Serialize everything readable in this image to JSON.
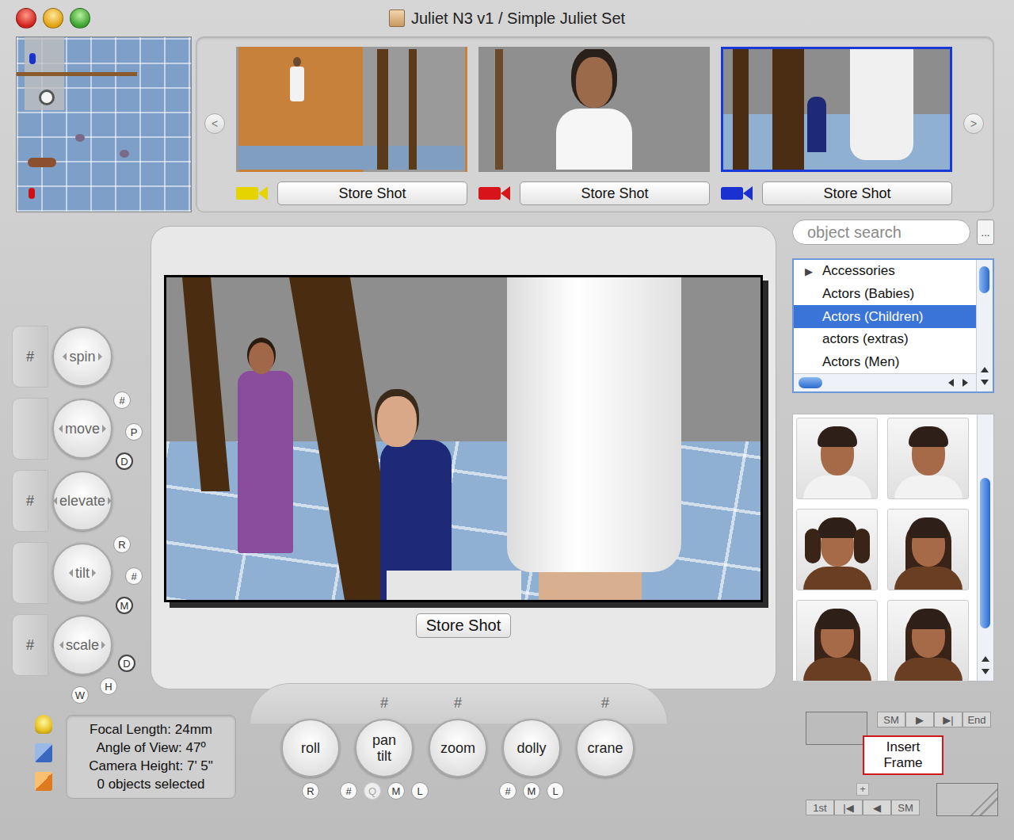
{
  "window": {
    "title": "Juliet N3 v1 / Simple Juliet Set"
  },
  "shot_strip": {
    "prev": "<",
    "next": ">",
    "shots": [
      {
        "camera_color": "#e6d400",
        "button": "Store Shot",
        "selected": false
      },
      {
        "camera_color": "#d8141a",
        "button": "Store Shot",
        "selected": false
      },
      {
        "camera_color": "#1a30d0",
        "button": "Store Shot",
        "selected": true
      }
    ]
  },
  "object_controls": [
    {
      "label": "spin",
      "side_mark": "#",
      "badges": []
    },
    {
      "label": "move",
      "badges": [
        "#",
        "P",
        "D"
      ]
    },
    {
      "label": "elevate",
      "side_mark": "#",
      "badges": []
    },
    {
      "label": "tilt",
      "badges": [
        "R",
        "#",
        "M"
      ]
    },
    {
      "label": "scale",
      "side_mark": "#",
      "badges": [
        "D",
        "H",
        "W"
      ]
    }
  ],
  "viewport": {
    "button": "Store Shot"
  },
  "camera_info": [
    "Focal Length: 24mm",
    "Angle of View: 47º",
    "Camera Height: 7' 5\"",
    "0 objects selected"
  ],
  "camera_controls": [
    {
      "label": "roll",
      "badges": [
        {
          "text": "R",
          "disabled": false
        }
      ]
    },
    {
      "label": "pan tilt",
      "top_mark": "#",
      "badges": [
        {
          "text": "#",
          "disabled": false
        },
        {
          "text": "Q",
          "disabled": true
        },
        {
          "text": "M",
          "disabled": false
        },
        {
          "text": "L",
          "disabled": false
        }
      ]
    },
    {
      "label": "zoom",
      "top_mark": "#",
      "badges": []
    },
    {
      "label": "dolly",
      "badges": [
        {
          "text": "#",
          "disabled": false
        },
        {
          "text": "M",
          "disabled": false
        },
        {
          "text": "L",
          "disabled": false
        }
      ]
    },
    {
      "label": "crane",
      "top_mark": "#",
      "badges": []
    }
  ],
  "library": {
    "search_placeholder": "object search",
    "options_button": "...",
    "disclosure_glyph": "▶",
    "categories": [
      {
        "label": "Accessories",
        "has_children": true,
        "selected": false
      },
      {
        "label": "Actors (Babies)",
        "has_children": false,
        "selected": false
      },
      {
        "label": "Actors (Children)",
        "has_children": false,
        "selected": true
      },
      {
        "label": "actors (extras)",
        "has_children": false,
        "selected": false
      },
      {
        "label": "Actors (Men)",
        "has_children": false,
        "selected": false
      }
    ],
    "thumbnails": [
      {
        "kind": "boy"
      },
      {
        "kind": "boy"
      },
      {
        "kind": "pigtails"
      },
      {
        "kind": "girl"
      },
      {
        "kind": "girl"
      },
      {
        "kind": "girl"
      }
    ]
  },
  "frame_controls": {
    "top_buttons": [
      "SM",
      "▶",
      "▶|",
      "End"
    ],
    "insert_button": "Insert Frame",
    "add": "+",
    "bottom_buttons": [
      "1st",
      "|◀",
      "◀",
      "SM"
    ]
  }
}
